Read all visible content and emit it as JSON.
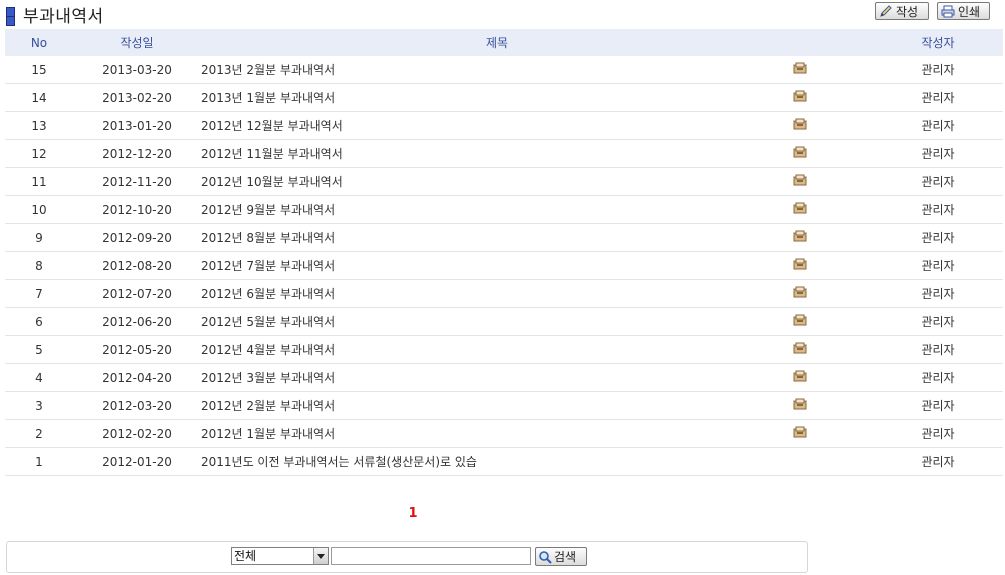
{
  "header": {
    "title": "부과내역서",
    "write_label": "작성",
    "print_label": "인쇄"
  },
  "table": {
    "columns": {
      "no": "No",
      "date": "작성일",
      "title": "제목",
      "author": "작성자"
    },
    "rows": [
      {
        "no": "15",
        "date": "2013-03-20",
        "title": "2013년 2월분 부과내역서",
        "has_file": true,
        "author": "관리자"
      },
      {
        "no": "14",
        "date": "2013-02-20",
        "title": "2013년 1월분 부과내역서",
        "has_file": true,
        "author": "관리자"
      },
      {
        "no": "13",
        "date": "2013-01-20",
        "title": "2012년 12월분 부과내역서",
        "has_file": true,
        "author": "관리자"
      },
      {
        "no": "12",
        "date": "2012-12-20",
        "title": "2012년 11월분 부과내역서",
        "has_file": true,
        "author": "관리자"
      },
      {
        "no": "11",
        "date": "2012-11-20",
        "title": "2012년 10월분 부과내역서",
        "has_file": true,
        "author": "관리자"
      },
      {
        "no": "10",
        "date": "2012-10-20",
        "title": "2012년 9월분 부과내역서",
        "has_file": true,
        "author": "관리자"
      },
      {
        "no": "9",
        "date": "2012-09-20",
        "title": "2012년 8월분 부과내역서",
        "has_file": true,
        "author": "관리자"
      },
      {
        "no": "8",
        "date": "2012-08-20",
        "title": "2012년 7월분 부과내역서",
        "has_file": true,
        "author": "관리자"
      },
      {
        "no": "7",
        "date": "2012-07-20",
        "title": "2012년 6월분 부과내역서",
        "has_file": true,
        "author": "관리자"
      },
      {
        "no": "6",
        "date": "2012-06-20",
        "title": "2012년 5월분 부과내역서",
        "has_file": true,
        "author": "관리자"
      },
      {
        "no": "5",
        "date": "2012-05-20",
        "title": "2012년 4월분 부과내역서",
        "has_file": true,
        "author": "관리자"
      },
      {
        "no": "4",
        "date": "2012-04-20",
        "title": "2012년 3월분 부과내역서",
        "has_file": true,
        "author": "관리자"
      },
      {
        "no": "3",
        "date": "2012-03-20",
        "title": "2012년 2월분 부과내역서",
        "has_file": true,
        "author": "관리자"
      },
      {
        "no": "2",
        "date": "2012-02-20",
        "title": "2012년 1월분 부과내역서",
        "has_file": true,
        "author": "관리자"
      },
      {
        "no": "1",
        "date": "2012-01-20",
        "title": "2011년도 이전 부과내역서는 서류철(생산문서)로 있습",
        "has_file": false,
        "author": "관리자"
      }
    ],
    "file_icon": "attachment-icon"
  },
  "pagination": {
    "current_page": "1"
  },
  "search": {
    "scope_selected": "전체",
    "keyword_value": "",
    "button_label": "검색"
  },
  "colors": {
    "header_bg": "#e8edf8",
    "header_text": "#3a4f9c",
    "current_page": "#e01010"
  }
}
